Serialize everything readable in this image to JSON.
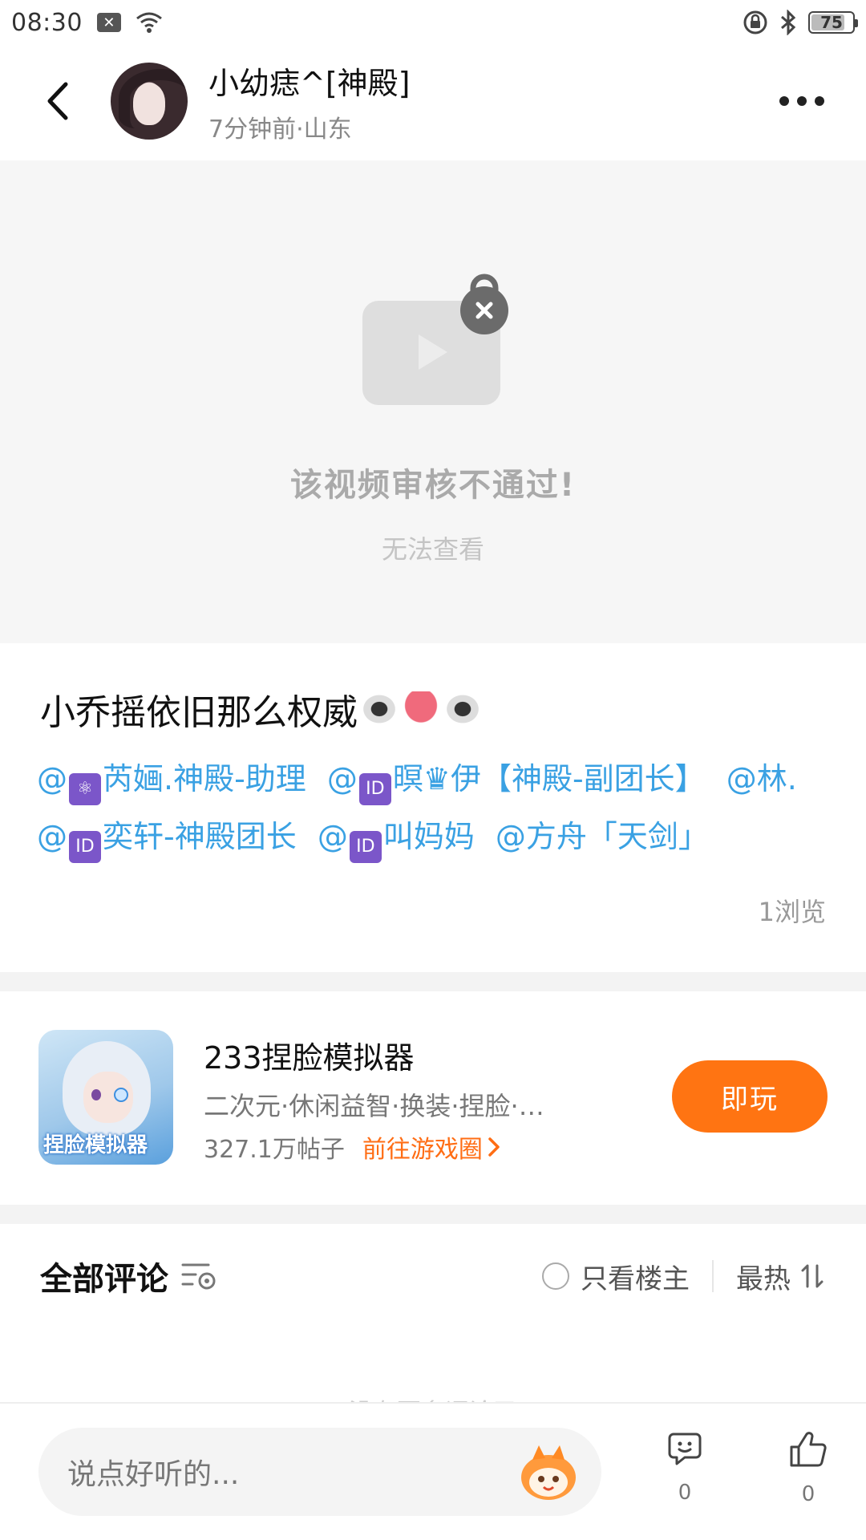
{
  "status_bar": {
    "time": "08:30",
    "battery": "75"
  },
  "header": {
    "username": "小幼痣^[神殿]",
    "meta": "7分钟前·山东"
  },
  "video": {
    "blocked_title": "该视频审核不通过!",
    "blocked_sub": "无法查看"
  },
  "post": {
    "title": "小乔摇依旧那么权威",
    "mentions": [
      {
        "prefix": "@",
        "badge": "⚛",
        "name": "芮婳.神殿-助理"
      },
      {
        "prefix": "@",
        "badge": "ID",
        "name": "暝♛伊【神殿-副团长】"
      },
      {
        "prefix": "@",
        "badge": "",
        "name": "林."
      },
      {
        "prefix": "@",
        "badge": "ID",
        "name": "奕轩-神殿团长"
      },
      {
        "prefix": "@",
        "badge": "ID",
        "name": "叫妈妈"
      },
      {
        "prefix": "@",
        "badge": "",
        "name": "方舟「天剑」"
      }
    ],
    "views": "1浏览"
  },
  "game_card": {
    "name": "233捏脸模拟器",
    "tags": "二次元·休闲益智·换装·捏脸·…",
    "posts": "327.1万帖子",
    "goto_label": "前往游戏圈",
    "play_label": "即玩",
    "icon_text": "捏脸模拟器",
    "accent": "#ff7412"
  },
  "comments": {
    "title": "全部评论",
    "only_op_label": "只看楼主",
    "sort_label": "最热",
    "empty_hint": "没有更多评论了"
  },
  "bottom_bar": {
    "input_placeholder": "说点好听的...",
    "comment_count": "0",
    "like_count": "0"
  }
}
